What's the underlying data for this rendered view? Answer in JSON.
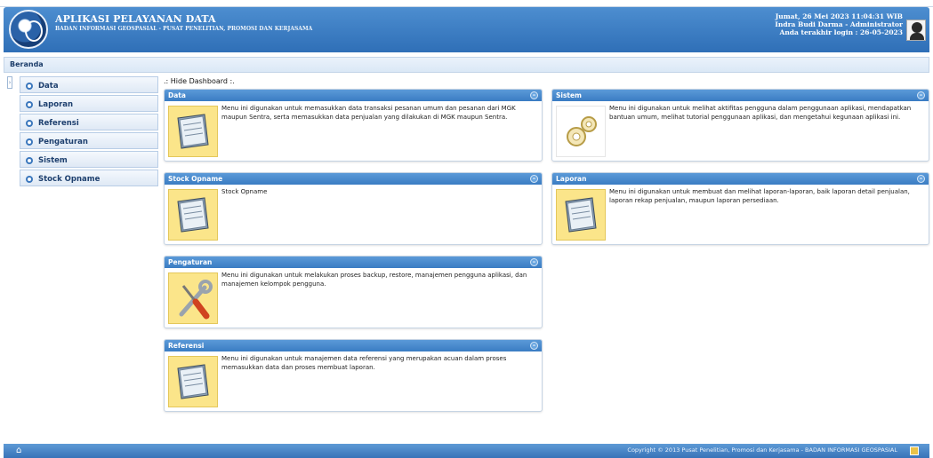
{
  "header": {
    "title": "APLIKASI PELAYANAN DATA",
    "subtitle": "BADAN INFORMASI GEOSPASIAL - PUSAT PENELITIAN, PROMOSI DAN KERJASAMA",
    "datetime": "Jumat, 26 Mei 2023 11:04:31 WIB",
    "user": "Indra Budi Darma - Administrator",
    "last_login": "Anda terakhir login : 26-05-2023"
  },
  "breadcrumb": "Beranda",
  "sidebar": {
    "items": [
      {
        "label": "Data"
      },
      {
        "label": "Laporan"
      },
      {
        "label": "Referensi"
      },
      {
        "label": "Pengaturan"
      },
      {
        "label": "Sistem"
      },
      {
        "label": "Stock Opname"
      }
    ]
  },
  "dashboard": {
    "hide_label": ".: Hide Dashboard :.",
    "panels": {
      "data": {
        "title": "Data",
        "desc": "Menu ini digunakan untuk memasukkan data transaksi pesanan umum dan pesanan dari MGK maupun Sentra, serta memasukkan data penjualan yang dilakukan di MGK maupun Sentra.",
        "icon": "document-icon"
      },
      "sistem": {
        "title": "Sistem",
        "desc": "Menu ini digunakan untuk melihat aktifitas pengguna dalam penggunaan aplikasi, mendapatkan bantuan umum, melihat tutorial penggunaan aplikasi, dan mengetahui kegunaan aplikasi ini.",
        "icon": "gears-icon"
      },
      "stock": {
        "title": "Stock Opname",
        "desc": "Stock Opname",
        "icon": "document-icon"
      },
      "laporan": {
        "title": "Laporan",
        "desc": "Menu ini digunakan untuk membuat dan melihat laporan-laporan, baik laporan detail penjualan, laporan rekap penjualan, maupun laporan persediaan.",
        "icon": "document-icon"
      },
      "pengaturan": {
        "title": "Pengaturan",
        "desc": "Menu ini digunakan untuk melakukan proses backup, restore, manajemen pengguna aplikasi, dan manajemen kelompok pengguna.",
        "icon": "tools-icon"
      },
      "referensi": {
        "title": "Referensi",
        "desc": "Menu ini digunakan untuk manajemen data referensi yang merupakan acuan dalam proses memasukkan data dan proses membuat laporan.",
        "icon": "document-icon"
      }
    },
    "minimize_symbol": "–"
  },
  "footer": {
    "copyright": "Copyright © 2013 Pusat Penelitian, Promosi dan Kerjasama - BADAN INFORMASI GEOSPASIAL",
    "home_icon": "home-icon"
  },
  "colors": {
    "header_blue": "#3a7cc3",
    "panel_head": "#4a8bd0",
    "icon_bg": "#fbe58a"
  }
}
